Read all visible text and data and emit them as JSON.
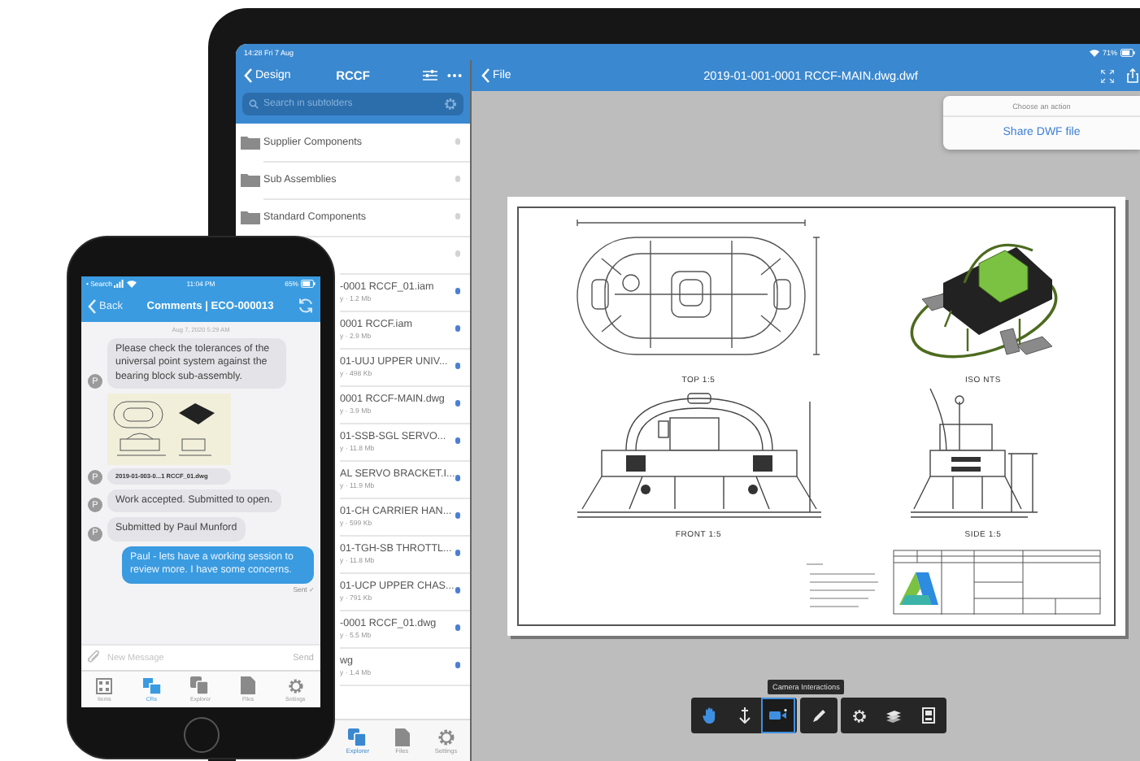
{
  "ipad": {
    "status_bar": {
      "time": "14:28 Fri 7 Aug",
      "battery": "71%"
    },
    "browser": {
      "back": "Design",
      "title": "RCCF",
      "search": {
        "placeholder": "Search in subfolders"
      },
      "items": [
        {
          "kind": "folder",
          "name": "Supplier Components"
        },
        {
          "kind": "folder",
          "name": "Sub Assemblies"
        },
        {
          "kind": "folder",
          "name": "Standard Components"
        },
        {
          "kind": "folder"
        },
        {
          "kind": "file",
          "name": "-0001 RCCF_01.iam",
          "meta": "y · 1.2 Mb"
        },
        {
          "kind": "file",
          "name": "0001 RCCF.iam",
          "meta": "y · 2.9 Mb"
        },
        {
          "kind": "file",
          "name": "01-UUJ UPPER UNIV...",
          "meta": "y · 498 Kb"
        },
        {
          "kind": "file",
          "name": "0001 RCCF-MAIN.dwg",
          "meta": "y · 3.9 Mb"
        },
        {
          "kind": "file",
          "name": "01-SSB-SGL SERVO...",
          "meta": "y · 11.8 Mb"
        },
        {
          "kind": "file",
          "name": "AL SERVO BRACKET.I...",
          "meta": "y · 11.9 Mb"
        },
        {
          "kind": "file",
          "name": "01-CH CARRIER HAN...",
          "meta": "y · 599 Kb"
        },
        {
          "kind": "file",
          "name": "01-TGH-SB THROTTL...",
          "meta": "y · 11.8 Mb"
        },
        {
          "kind": "file",
          "name": "01-UCP UPPER CHAS...",
          "meta": "y · 791 Kb"
        },
        {
          "kind": "file",
          "name": "-0001 RCCF_01.dwg",
          "meta": "y · 5.5 Mb"
        },
        {
          "kind": "file",
          "name": "wg",
          "meta": "y · 1.4 Mb"
        }
      ],
      "tabs": [
        {
          "label": "Explorer",
          "selected": true
        },
        {
          "label": "Files",
          "selected": false
        },
        {
          "label": "Settings",
          "selected": false
        }
      ]
    },
    "viewer": {
      "back": "File",
      "title": "2019-01-001-0001 RCCF-MAIN.dwg.dwf",
      "popover": {
        "heading": "Choose an action",
        "action": "Share DWF file"
      },
      "sheet": {
        "views": [
          "TOP 1:5",
          "ISO NTS",
          "FRONT 1:5",
          "SIDE 1:5"
        ]
      },
      "tooltip": "Camera Interactions",
      "tool_groups": [
        {
          "tools": [
            {
              "selected": false
            },
            {
              "selected": false
            },
            {
              "selected": true
            }
          ]
        },
        {
          "tools": [
            {
              "selected": false
            }
          ]
        },
        {
          "tools": [
            {
              "selected": false
            },
            {
              "selected": false
            },
            {
              "selected": false
            }
          ]
        }
      ]
    }
  },
  "phone": {
    "status_bar": {
      "carrier": "• Search",
      "time": "11:04 PM",
      "battery": "65%"
    },
    "nav": {
      "back": "Back",
      "title": "Comments | ECO-000013"
    },
    "timestamp": "Aug 7, 2020 5:29 AM",
    "messages": [
      {
        "kind": "incoming",
        "avatar": "P",
        "text": "Please check the tolerances of the universal  point system against the bearing block sub-assembly."
      },
      {
        "kind": "attachment",
        "avatar": "P",
        "text": "2019-01-003-0...1 RCCF_01.dwg"
      },
      {
        "kind": "incoming",
        "avatar": "P",
        "text": "Work accepted. Submitted to open."
      },
      {
        "kind": "incoming",
        "avatar": "P",
        "text": "Submitted by Paul Munford"
      },
      {
        "kind": "outgoing",
        "text": "Paul - lets have a working session to review more. I have some concerns.",
        "status": "Sent ✓"
      }
    ],
    "composer": {
      "placeholder": "New Message",
      "send": "Send"
    },
    "tabs": [
      {
        "label": "Items",
        "selected": false
      },
      {
        "label": "CRs",
        "selected": true
      },
      {
        "label": "Explorer",
        "selected": false
      },
      {
        "label": "Files",
        "selected": false
      },
      {
        "label": "Settings",
        "selected": false
      }
    ]
  }
}
